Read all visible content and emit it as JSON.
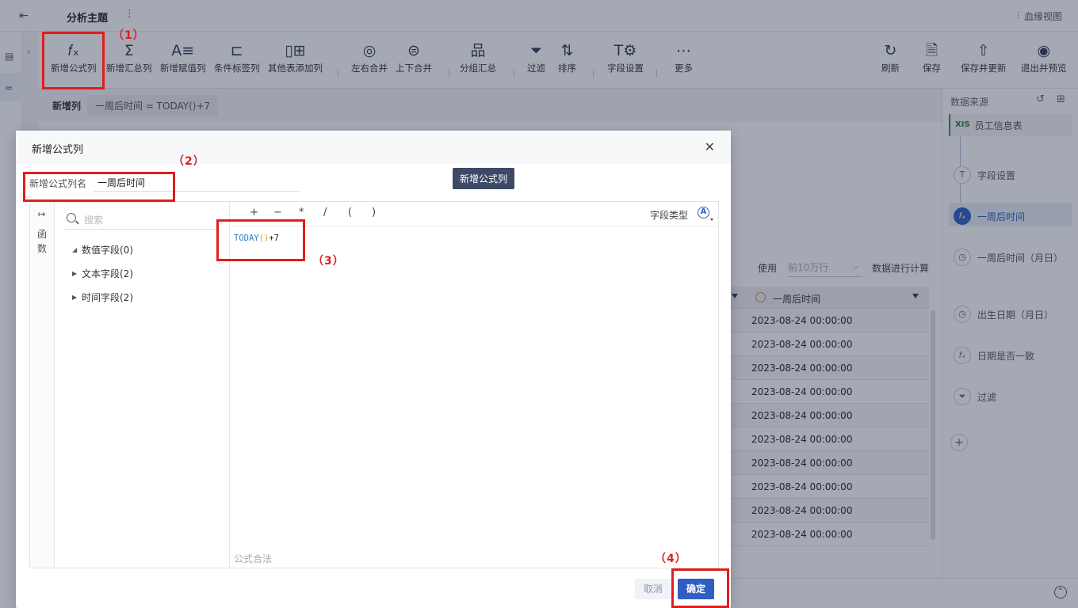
{
  "topbar": {
    "title": "分析主题",
    "more": "⋮",
    "lineage": "血缘视图"
  },
  "toolbar": {
    "items": [
      {
        "label": "新增公式列",
        "icon": "formula-icon",
        "glyph": "𝑓ₓ"
      },
      {
        "label": "新增汇总列",
        "icon": "sum-icon",
        "glyph": "Σ"
      },
      {
        "label": "新增赋值列",
        "icon": "assign-icon",
        "glyph": "A≡"
      },
      {
        "label": "条件标签列",
        "icon": "condition-tag-icon",
        "glyph": "⊏"
      },
      {
        "label": "其他表添加列",
        "icon": "add-column-icon",
        "glyph": "▯⊞"
      },
      {
        "label": "左右合并",
        "icon": "merge-lr-icon",
        "glyph": "◎"
      },
      {
        "label": "上下合并",
        "icon": "merge-ud-icon",
        "glyph": "⊜"
      },
      {
        "label": "分组汇总",
        "icon": "group-icon",
        "glyph": "品"
      },
      {
        "label": "过滤",
        "icon": "filter-icon",
        "glyph": "⏷"
      },
      {
        "label": "排序",
        "icon": "sort-icon",
        "glyph": "⇅"
      },
      {
        "label": "字段设置",
        "icon": "field-settings-icon",
        "glyph": "T⚙"
      },
      {
        "label": "更多",
        "icon": "more-icon",
        "glyph": "⋯"
      }
    ],
    "right": [
      {
        "label": "刷新",
        "icon": "refresh-icon",
        "glyph": "↻"
      },
      {
        "label": "保存",
        "icon": "save-icon",
        "glyph": "🗎"
      },
      {
        "label": "保存并更新",
        "icon": "save-update-icon",
        "glyph": "⇧"
      },
      {
        "label": "退出并预览",
        "icon": "exit-preview-icon",
        "glyph": "◉"
      }
    ]
  },
  "formula_bar": {
    "label": "新增列",
    "chip": "一周后时间 = TODAY()+7"
  },
  "use_row": {
    "prefix": "使用",
    "select": "前10万行",
    "suffix": "数据进行计算"
  },
  "grid": {
    "header": "一周后时间",
    "rows": [
      "2023-08-24 00:00:00",
      "2023-08-24 00:00:00",
      "2023-08-24 00:00:00",
      "2023-08-24 00:00:00",
      "2023-08-24 00:00:00",
      "2023-08-24 00:00:00",
      "2023-08-24 00:00:00",
      "2023-08-24 00:00:00",
      "2023-08-24 00:00:00",
      "2023-08-24 00:00:00"
    ]
  },
  "right_panel": {
    "title": "数据来源",
    "source": {
      "tag": "XIS",
      "label": "员工信息表"
    },
    "steps": [
      {
        "label": "字段设置",
        "glyph": "T"
      },
      {
        "label": "一周后时间",
        "glyph": "𝑓ₓ"
      },
      {
        "label": "一周后时间（月日）",
        "glyph": "◷"
      },
      {
        "label": "出生日期（月日）",
        "glyph": "◷"
      },
      {
        "label": "日期是否一致",
        "glyph": "𝑓ₓ"
      },
      {
        "label": "过滤",
        "glyph": "⏷"
      }
    ],
    "add": "+"
  },
  "dialog": {
    "title": "新增公式列",
    "close": "✕",
    "tooltip": "新增公式列",
    "name_label": "新增公式列名",
    "name_value": "一周后时间",
    "rail_label": "函数",
    "search_placeholder": "搜索",
    "tree": [
      "数值字段(0)",
      "文本字段(2)",
      "时间字段(2)"
    ],
    "operators": [
      "+",
      "−",
      "*",
      "/",
      "(",
      ")"
    ],
    "field_type_label": "字段类型",
    "field_type_glyph": "A",
    "formula": {
      "fn": "TODAY",
      "open": "(",
      "close": ")",
      "rest": "+7"
    },
    "legal": "公式合法",
    "cancel": "取消",
    "ok": "确定"
  },
  "annotations": [
    "（1）",
    "（2）",
    "（3）",
    "（4）"
  ],
  "colors": {
    "accent": "#2f5ec4",
    "annotation": "#e11d1d",
    "overlay": "rgba(30,41,64,0.40)"
  }
}
